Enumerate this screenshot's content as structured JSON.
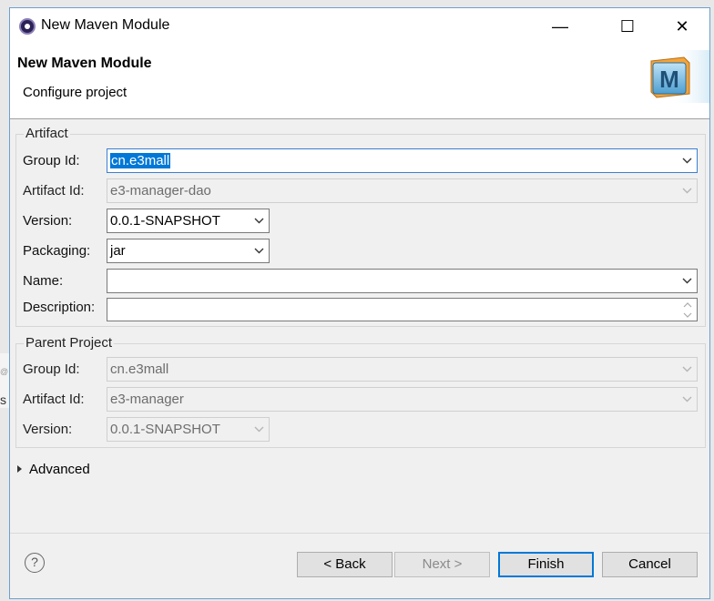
{
  "window": {
    "title": "New Maven Module",
    "minimize": "—",
    "maximize": "☐",
    "close": "✕"
  },
  "header": {
    "title": "New Maven Module",
    "subtitle": "Configure project"
  },
  "artifact": {
    "legend": "Artifact",
    "group_id_label": "Group Id:",
    "group_id_value": "cn.e3mall",
    "artifact_id_label": "Artifact Id:",
    "artifact_id_value": "e3-manager-dao",
    "version_label": "Version:",
    "version_value": "0.0.1-SNAPSHOT",
    "packaging_label": "Packaging:",
    "packaging_value": "jar",
    "name_label": "Name:",
    "name_value": "",
    "description_label": "Description:",
    "description_value": ""
  },
  "parent": {
    "legend": "Parent Project",
    "group_id_label": "Group Id:",
    "group_id_value": "cn.e3mall",
    "artifact_id_label": "Artifact Id:",
    "artifact_id_value": "e3-manager",
    "version_label": "Version:",
    "version_value": "0.0.1-SNAPSHOT"
  },
  "advanced_label": "Advanced",
  "help_icon": "?",
  "buttons": {
    "back": "< Back",
    "next": "Next >",
    "finish": "Finish",
    "cancel": "Cancel"
  },
  "colors": {
    "selection": "#0078d7",
    "border": "#6d9fd0",
    "dialog_bg": "#f0f0f0"
  },
  "icons": [
    "eclipse-icon",
    "maven-logo-icon",
    "chevron-down-icon",
    "help-icon",
    "triangle-right-icon"
  ]
}
